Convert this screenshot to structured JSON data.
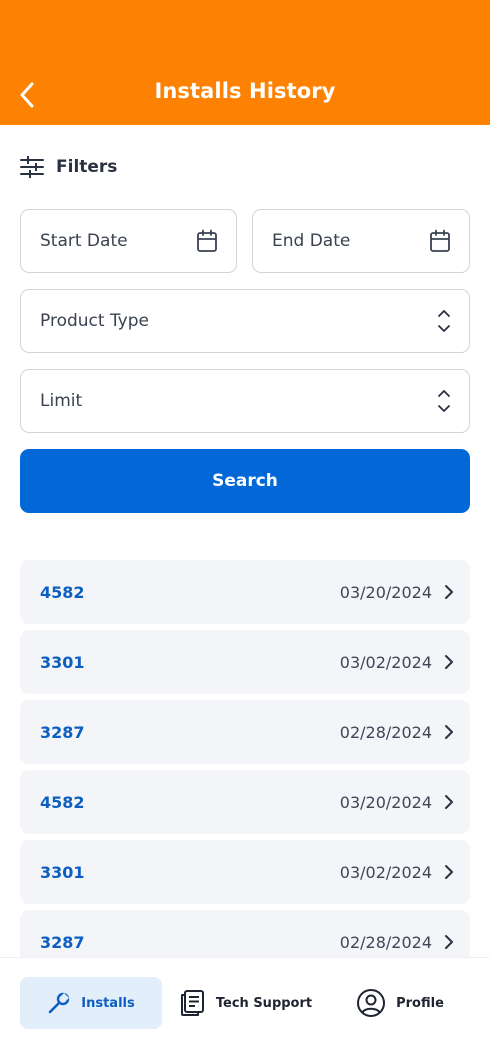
{
  "header": {
    "title": "Installs History",
    "back_icon": "chevron-left-icon"
  },
  "filters": {
    "label": "Filters",
    "icon": "sliders-icon"
  },
  "form": {
    "start_date": {
      "label": "Start Date",
      "icon": "calendar-icon"
    },
    "end_date": {
      "label": "End Date",
      "icon": "calendar-icon"
    },
    "product_type": {
      "label": "Product Type",
      "icon": "sort-arrows-icon"
    },
    "limit": {
      "label": "Limit",
      "icon": "sort-arrows-icon"
    },
    "search_label": "Search"
  },
  "installs": [
    {
      "id": "4582",
      "date": "03/20/2024"
    },
    {
      "id": "3301",
      "date": "03/02/2024"
    },
    {
      "id": "3287",
      "date": "02/28/2024"
    },
    {
      "id": "4582",
      "date": "03/20/2024"
    },
    {
      "id": "3301",
      "date": "03/02/2024"
    },
    {
      "id": "3287",
      "date": "02/28/2024"
    }
  ],
  "nav": {
    "installs": "Installs",
    "tech_support": "Tech Support",
    "profile": "Profile"
  },
  "colors": {
    "header": "#fd8204",
    "primary": "#0268d8",
    "link": "#0c5fc1",
    "row_bg": "#f4f5f9",
    "active_nav_bg": "#e3eefb"
  }
}
